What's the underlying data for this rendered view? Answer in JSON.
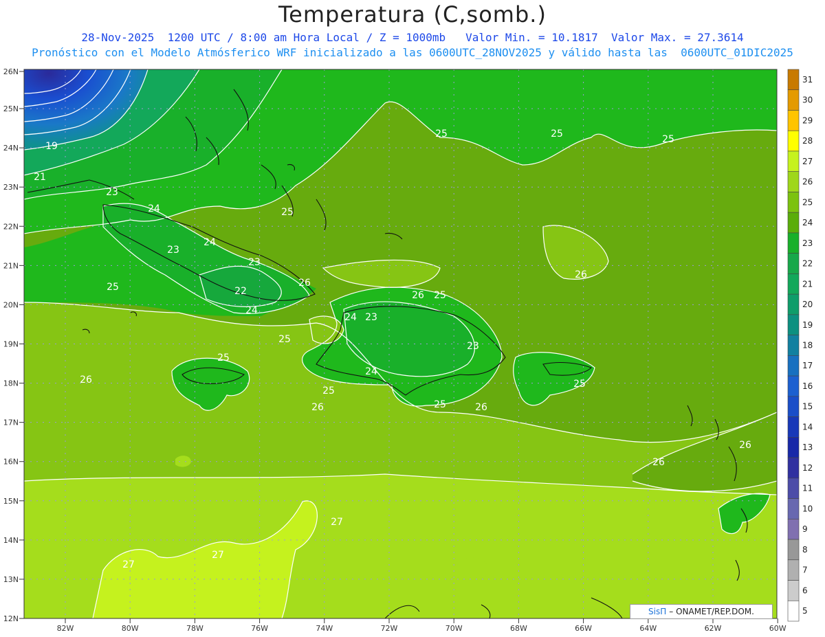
{
  "header": {
    "title": "Temperatura (C,somb.)",
    "subtitle1": "28-Nov-2025  1200 UTC / 8:00 am Hora Local / Z = 1000mb   Valor Min. = 10.1817  Valor Max. = 27.3614",
    "subtitle2": "Pronóstico con el Modelo Atmósferico WRF inicializado a las 0600UTC_28NOV2025 y válido hasta las  0600UTC_01DIC2025"
  },
  "map": {
    "lat_labels": [
      "26N",
      "25N",
      "24N",
      "23N",
      "22N",
      "21N",
      "20N",
      "19N",
      "18N",
      "17N",
      "16N",
      "15N",
      "14N",
      "13N",
      "12N"
    ],
    "lon_labels": [
      "82W",
      "80W",
      "78W",
      "76W",
      "74W",
      "72W",
      "70W",
      "68W",
      "66W",
      "64W",
      "62W",
      "60W"
    ],
    "contour_labels": [
      "19",
      "21",
      "23",
      "24",
      "24",
      "23",
      "23",
      "22",
      "24",
      "25",
      "25",
      "26",
      "26",
      "25",
      "24",
      "23",
      "23",
      "24",
      "25",
      "25",
      "25",
      "25",
      "25",
      "25",
      "26",
      "26",
      "26",
      "25",
      "25",
      "26",
      "27",
      "27",
      "27",
      "26",
      "26"
    ],
    "colors": {
      "c19": "#0a8a80",
      "c20": "#07977a",
      "c21": "#13a85a",
      "c22": "#16a83c",
      "c23": "#19b02a",
      "c24": "#1fb81c",
      "c25": "#67ab0e",
      "c26": "#86c514",
      "c27": "#a5dd1c",
      "c28": "#c5f21e",
      "cold1": "#1e3fb8",
      "cold2": "#1850c8",
      "cold3": "#2060d0"
    }
  },
  "colorbar": {
    "levels": [
      "31",
      "30",
      "29",
      "28",
      "27",
      "26",
      "25",
      "24",
      "23",
      "22",
      "21",
      "20",
      "19",
      "18",
      "17",
      "16",
      "15",
      "14",
      "13",
      "12",
      "11",
      "10",
      "9",
      "8",
      "7",
      "6",
      "5"
    ],
    "colors": [
      "#c87a00",
      "#e49a00",
      "#ffc400",
      "#ffff00",
      "#c6f21e",
      "#9fd71a",
      "#7cc20f",
      "#5aad0a",
      "#19b02a",
      "#18a84a",
      "#13a85a",
      "#0f9d6a",
      "#0c9080",
      "#1180a0",
      "#1870c0",
      "#1c60d0",
      "#1a4ec8",
      "#1838b8",
      "#1828a8",
      "#3030a0",
      "#4c4ca8",
      "#6868b0",
      "#8070b0",
      "#989898",
      "#b0b0b0",
      "#cccccc",
      "#ffffff"
    ]
  },
  "footer": {
    "brand": "SisΠ",
    "text": "– ONAMET/REP.DOM."
  }
}
